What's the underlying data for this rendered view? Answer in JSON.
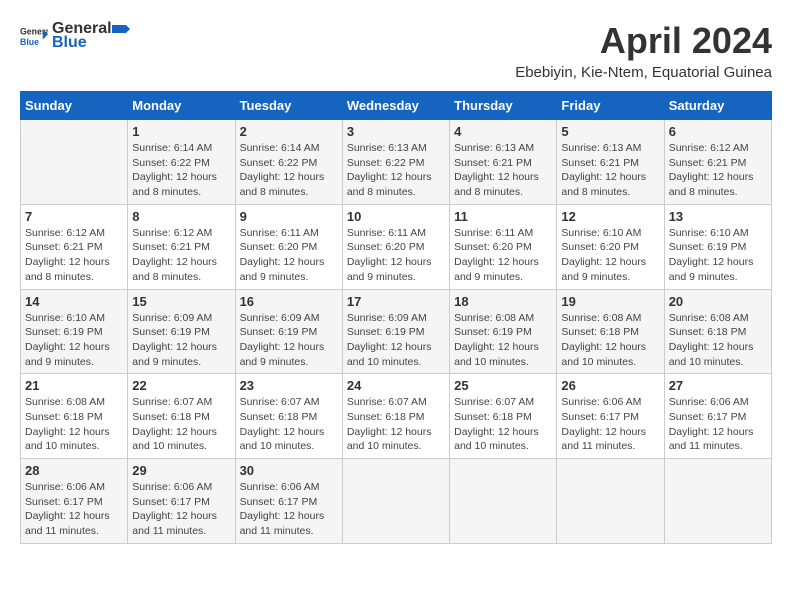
{
  "header": {
    "logo_general": "General",
    "logo_blue": "Blue",
    "month_title": "April 2024",
    "subtitle": "Ebebiyin, Kie-Ntem, Equatorial Guinea"
  },
  "weekdays": [
    "Sunday",
    "Monday",
    "Tuesday",
    "Wednesday",
    "Thursday",
    "Friday",
    "Saturday"
  ],
  "weeks": [
    [
      {
        "day": "",
        "info": ""
      },
      {
        "day": "1",
        "info": "Sunrise: 6:14 AM\nSunset: 6:22 PM\nDaylight: 12 hours\nand 8 minutes."
      },
      {
        "day": "2",
        "info": "Sunrise: 6:14 AM\nSunset: 6:22 PM\nDaylight: 12 hours\nand 8 minutes."
      },
      {
        "day": "3",
        "info": "Sunrise: 6:13 AM\nSunset: 6:22 PM\nDaylight: 12 hours\nand 8 minutes."
      },
      {
        "day": "4",
        "info": "Sunrise: 6:13 AM\nSunset: 6:21 PM\nDaylight: 12 hours\nand 8 minutes."
      },
      {
        "day": "5",
        "info": "Sunrise: 6:13 AM\nSunset: 6:21 PM\nDaylight: 12 hours\nand 8 minutes."
      },
      {
        "day": "6",
        "info": "Sunrise: 6:12 AM\nSunset: 6:21 PM\nDaylight: 12 hours\nand 8 minutes."
      }
    ],
    [
      {
        "day": "7",
        "info": "Sunrise: 6:12 AM\nSunset: 6:21 PM\nDaylight: 12 hours\nand 8 minutes."
      },
      {
        "day": "8",
        "info": "Sunrise: 6:12 AM\nSunset: 6:21 PM\nDaylight: 12 hours\nand 8 minutes."
      },
      {
        "day": "9",
        "info": "Sunrise: 6:11 AM\nSunset: 6:20 PM\nDaylight: 12 hours\nand 9 minutes."
      },
      {
        "day": "10",
        "info": "Sunrise: 6:11 AM\nSunset: 6:20 PM\nDaylight: 12 hours\nand 9 minutes."
      },
      {
        "day": "11",
        "info": "Sunrise: 6:11 AM\nSunset: 6:20 PM\nDaylight: 12 hours\nand 9 minutes."
      },
      {
        "day": "12",
        "info": "Sunrise: 6:10 AM\nSunset: 6:20 PM\nDaylight: 12 hours\nand 9 minutes."
      },
      {
        "day": "13",
        "info": "Sunrise: 6:10 AM\nSunset: 6:19 PM\nDaylight: 12 hours\nand 9 minutes."
      }
    ],
    [
      {
        "day": "14",
        "info": "Sunrise: 6:10 AM\nSunset: 6:19 PM\nDaylight: 12 hours\nand 9 minutes."
      },
      {
        "day": "15",
        "info": "Sunrise: 6:09 AM\nSunset: 6:19 PM\nDaylight: 12 hours\nand 9 minutes."
      },
      {
        "day": "16",
        "info": "Sunrise: 6:09 AM\nSunset: 6:19 PM\nDaylight: 12 hours\nand 9 minutes."
      },
      {
        "day": "17",
        "info": "Sunrise: 6:09 AM\nSunset: 6:19 PM\nDaylight: 12 hours\nand 10 minutes."
      },
      {
        "day": "18",
        "info": "Sunrise: 6:08 AM\nSunset: 6:19 PM\nDaylight: 12 hours\nand 10 minutes."
      },
      {
        "day": "19",
        "info": "Sunrise: 6:08 AM\nSunset: 6:18 PM\nDaylight: 12 hours\nand 10 minutes."
      },
      {
        "day": "20",
        "info": "Sunrise: 6:08 AM\nSunset: 6:18 PM\nDaylight: 12 hours\nand 10 minutes."
      }
    ],
    [
      {
        "day": "21",
        "info": "Sunrise: 6:08 AM\nSunset: 6:18 PM\nDaylight: 12 hours\nand 10 minutes."
      },
      {
        "day": "22",
        "info": "Sunrise: 6:07 AM\nSunset: 6:18 PM\nDaylight: 12 hours\nand 10 minutes."
      },
      {
        "day": "23",
        "info": "Sunrise: 6:07 AM\nSunset: 6:18 PM\nDaylight: 12 hours\nand 10 minutes."
      },
      {
        "day": "24",
        "info": "Sunrise: 6:07 AM\nSunset: 6:18 PM\nDaylight: 12 hours\nand 10 minutes."
      },
      {
        "day": "25",
        "info": "Sunrise: 6:07 AM\nSunset: 6:18 PM\nDaylight: 12 hours\nand 10 minutes."
      },
      {
        "day": "26",
        "info": "Sunrise: 6:06 AM\nSunset: 6:17 PM\nDaylight: 12 hours\nand 11 minutes."
      },
      {
        "day": "27",
        "info": "Sunrise: 6:06 AM\nSunset: 6:17 PM\nDaylight: 12 hours\nand 11 minutes."
      }
    ],
    [
      {
        "day": "28",
        "info": "Sunrise: 6:06 AM\nSunset: 6:17 PM\nDaylight: 12 hours\nand 11 minutes."
      },
      {
        "day": "29",
        "info": "Sunrise: 6:06 AM\nSunset: 6:17 PM\nDaylight: 12 hours\nand 11 minutes."
      },
      {
        "day": "30",
        "info": "Sunrise: 6:06 AM\nSunset: 6:17 PM\nDaylight: 12 hours\nand 11 minutes."
      },
      {
        "day": "",
        "info": ""
      },
      {
        "day": "",
        "info": ""
      },
      {
        "day": "",
        "info": ""
      },
      {
        "day": "",
        "info": ""
      }
    ]
  ]
}
